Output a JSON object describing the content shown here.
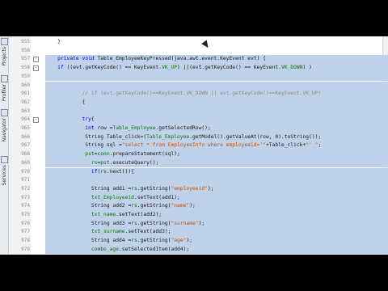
{
  "sidebar": {
    "tabs": [
      {
        "label": "Projects",
        "icon": "projects-icon"
      },
      {
        "label": "Profiler",
        "icon": "profiler-icon"
      },
      {
        "label": "Navigator",
        "icon": "navigator-icon"
      },
      {
        "label": "Services",
        "icon": "services-icon"
      }
    ]
  },
  "editor": {
    "lines": [
      {
        "n": "955",
        "parts": [
          {
            "t": "    }",
            "c": ""
          }
        ],
        "sel": false
      },
      {
        "n": "956",
        "parts": [],
        "sel": false
      },
      {
        "n": "957",
        "parts": [
          {
            "t": "    private void ",
            "c": "kw"
          },
          {
            "t": "Table_EmployeeKeyPressed(java.awt.event.KeyEvent evt) {",
            "c": ""
          }
        ],
        "sel": true
      },
      {
        "n": "958",
        "parts": [
          {
            "t": "    if ",
            "c": "kw"
          },
          {
            "t": "((evt.getKeyCode() == KeyEvent.",
            "c": ""
          },
          {
            "t": "VK_UP",
            "c": "fld"
          },
          {
            "t": ") ||(evt.getKeyCode() == KeyEvent.",
            "c": ""
          },
          {
            "t": "VK_DOWN",
            "c": "fld"
          },
          {
            "t": ") )",
            "c": ""
          }
        ],
        "sel": true
      },
      {
        "n": "959",
        "parts": [],
        "sel": true
      },
      {
        "n": "960",
        "parts": [],
        "sel": true
      },
      {
        "n": "961",
        "parts": [
          {
            "t": "            // if (evt.getKeyCode()==KeyEvent.VK_DOWN || evt.getKeyCode()==KeyEvent.VK_UP)",
            "c": "cmt"
          }
        ],
        "sel": true
      },
      {
        "n": "962",
        "parts": [
          {
            "t": "            {",
            "c": ""
          }
        ],
        "sel": true
      },
      {
        "n": "963",
        "parts": [],
        "sel": true
      },
      {
        "n": "964",
        "parts": [
          {
            "t": "            try",
            "c": "kw"
          },
          {
            "t": "{",
            "c": ""
          }
        ],
        "sel": true
      },
      {
        "n": "965",
        "parts": [
          {
            "t": "             int ",
            "c": "kw"
          },
          {
            "t": "row =",
            "c": ""
          },
          {
            "t": "Table_Employee",
            "c": "fld"
          },
          {
            "t": ".getSelectedRow();",
            "c": ""
          }
        ],
        "sel": true
      },
      {
        "n": "966",
        "parts": [
          {
            "t": "             String Table_click=(",
            "c": ""
          },
          {
            "t": "Table_Employee",
            "c": "fld"
          },
          {
            "t": ".getModel().getValueAt(row, 0).toString());",
            "c": ""
          }
        ],
        "sel": true
      },
      {
        "n": "967",
        "parts": [
          {
            "t": "             String sql =",
            "c": ""
          },
          {
            "t": "\"select * from EmployeeInfo where employeeid='\"",
            "c": "str"
          },
          {
            "t": "+Table_click+",
            "c": ""
          },
          {
            "t": "\"' \"",
            "c": "str"
          },
          {
            "t": ";",
            "c": ""
          }
        ],
        "sel": true
      },
      {
        "n": "968",
        "parts": [
          {
            "t": "             ",
            "c": ""
          },
          {
            "t": "pst",
            "c": "fld"
          },
          {
            "t": "=",
            "c": ""
          },
          {
            "t": "conn",
            "c": "fld"
          },
          {
            "t": ".prepareStatement(sql);",
            "c": ""
          }
        ],
        "sel": true
      },
      {
        "n": "969",
        "parts": [
          {
            "t": "               ",
            "c": ""
          },
          {
            "t": "rs",
            "c": "fld"
          },
          {
            "t": "=",
            "c": ""
          },
          {
            "t": "pst",
            "c": "fld"
          },
          {
            "t": ".executeQuery();",
            "c": ""
          }
        ],
        "sel": true
      },
      {
        "n": "970",
        "parts": [
          {
            "t": "               if",
            "c": "kw"
          },
          {
            "t": "(",
            "c": ""
          },
          {
            "t": "rs",
            "c": "fld"
          },
          {
            "t": ".next()){",
            "c": ""
          }
        ],
        "sel": true
      },
      {
        "n": "971",
        "parts": [],
        "sel": true
      },
      {
        "n": "972",
        "parts": [
          {
            "t": "               String add1 =",
            "c": ""
          },
          {
            "t": "rs",
            "c": "fld"
          },
          {
            "t": ".getString(",
            "c": ""
          },
          {
            "t": "\"employeeid\"",
            "c": "str"
          },
          {
            "t": ");",
            "c": ""
          }
        ],
        "sel": true
      },
      {
        "n": "973",
        "parts": [
          {
            "t": "               ",
            "c": ""
          },
          {
            "t": "txt_Employeeid",
            "c": "fld"
          },
          {
            "t": ".setText(add1);",
            "c": ""
          }
        ],
        "sel": true
      },
      {
        "n": "974",
        "parts": [
          {
            "t": "               String add2 =",
            "c": ""
          },
          {
            "t": "rs",
            "c": "fld"
          },
          {
            "t": ".getString(",
            "c": ""
          },
          {
            "t": "\"name\"",
            "c": "str"
          },
          {
            "t": ");",
            "c": ""
          }
        ],
        "sel": true
      },
      {
        "n": "975",
        "parts": [
          {
            "t": "               ",
            "c": ""
          },
          {
            "t": "txt_name",
            "c": "fld"
          },
          {
            "t": ".setText(add2);",
            "c": ""
          }
        ],
        "sel": true
      },
      {
        "n": "976",
        "parts": [
          {
            "t": "               String add3 =",
            "c": ""
          },
          {
            "t": "rs",
            "c": "fld"
          },
          {
            "t": ".getString(",
            "c": ""
          },
          {
            "t": "\"surname\"",
            "c": "str"
          },
          {
            "t": ");",
            "c": ""
          }
        ],
        "sel": true
      },
      {
        "n": "977",
        "parts": [
          {
            "t": "               ",
            "c": ""
          },
          {
            "t": "txt_surname",
            "c": "fld"
          },
          {
            "t": ".setText(add3);",
            "c": ""
          }
        ],
        "sel": true
      },
      {
        "n": "978",
        "parts": [
          {
            "t": "               String add4 =",
            "c": ""
          },
          {
            "t": "rs",
            "c": "fld"
          },
          {
            "t": ".getString(",
            "c": ""
          },
          {
            "t": "\"age\"",
            "c": "str"
          },
          {
            "t": ");",
            "c": ""
          }
        ],
        "sel": true
      },
      {
        "n": "979",
        "parts": [
          {
            "t": "               ",
            "c": ""
          },
          {
            "t": "combo_age",
            "c": "fld"
          },
          {
            "t": ".setSelectedItem(add4);",
            "c": ""
          }
        ],
        "sel": true
      }
    ]
  }
}
